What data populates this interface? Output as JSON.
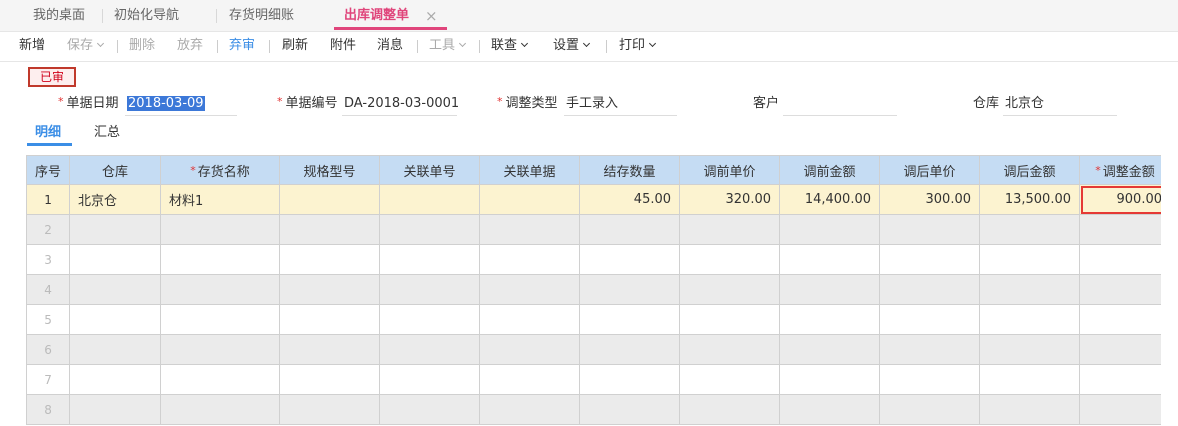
{
  "tabs": [
    {
      "label": "我的桌面"
    },
    {
      "label": "初始化导航"
    },
    {
      "label": "存货明细账"
    },
    {
      "label": "出库调整单",
      "active": true
    }
  ],
  "toolbar": {
    "add": "新增",
    "save": "保存",
    "delete": "删除",
    "discard": "放弃",
    "unaudit": "弃审",
    "refresh": "刷新",
    "attachment": "附件",
    "message": "消息",
    "tools": "工具",
    "linked_query": "联查",
    "settings": "设置",
    "print": "打印"
  },
  "status_badge": "已审",
  "form": {
    "date_label": "单据日期",
    "date_value": "2018-03-09",
    "docno_label": "单据编号",
    "docno_value": "DA-2018-03-0001",
    "adjtype_label": "调整类型",
    "adjtype_value": "手工录入",
    "customer_label": "客户",
    "customer_value": "",
    "warehouse_label": "仓库",
    "warehouse_value": "北京仓"
  },
  "subtabs": {
    "detail": "明细",
    "summary": "汇总"
  },
  "columns": [
    "序号",
    "仓库",
    "存货名称",
    "规格型号",
    "关联单号",
    "关联单据",
    "结存数量",
    "调前单价",
    "调前金额",
    "调后单价",
    "调后金额",
    "调整金额"
  ],
  "rows": [
    {
      "idx": "1",
      "warehouse": "北京仓",
      "item": "材料1",
      "spec": "",
      "ref_no": "",
      "ref_doc": "",
      "qty": "45.00",
      "pre_price": "320.00",
      "pre_amount": "14,400.00",
      "post_price": "300.00",
      "post_amount": "13,500.00",
      "adj_amount": "900.00"
    },
    {
      "idx": "2"
    },
    {
      "idx": "3"
    },
    {
      "idx": "4"
    },
    {
      "idx": "5"
    },
    {
      "idx": "6"
    },
    {
      "idx": "7"
    },
    {
      "idx": "8"
    }
  ],
  "colors": {
    "accent": "#e0457b",
    "primary": "#3b8ee6",
    "header_bg": "#c5dcf3",
    "selected_row": "#fcf3d0",
    "highlight_box": "#e53935"
  }
}
